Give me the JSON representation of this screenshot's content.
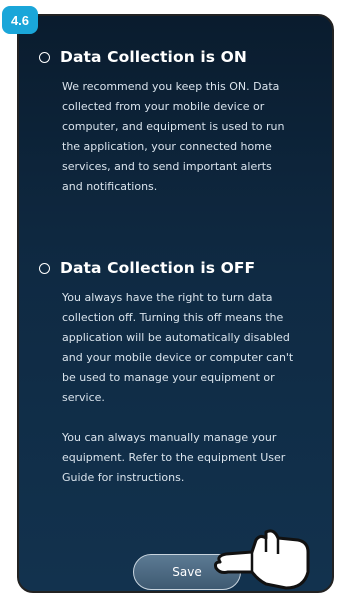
{
  "step_badge": "4.6",
  "options": [
    {
      "title": "Data Collection is ON",
      "description": "We recommend you keep this ON. Data\ncollected from your mobile device or\ncomputer, and equipment is used to run\nthe application, your connected home\nservices, and to send important alerts\nand notifications."
    },
    {
      "title": "Data Collection is OFF",
      "description": "You always have the right to turn data\ncollection off. Turning this off means the\napplication will be automatically disabled\nand your mobile device or computer can't\nbe used to manage your equipment or\nservice.",
      "description2": "You can always manually manage your\nequipment. Refer to the equipment User\nGuide for instructions."
    }
  ],
  "save_label": "Save",
  "icons": {
    "radio": "radio-empty-icon",
    "pointer": "hand-pointer-icon"
  }
}
